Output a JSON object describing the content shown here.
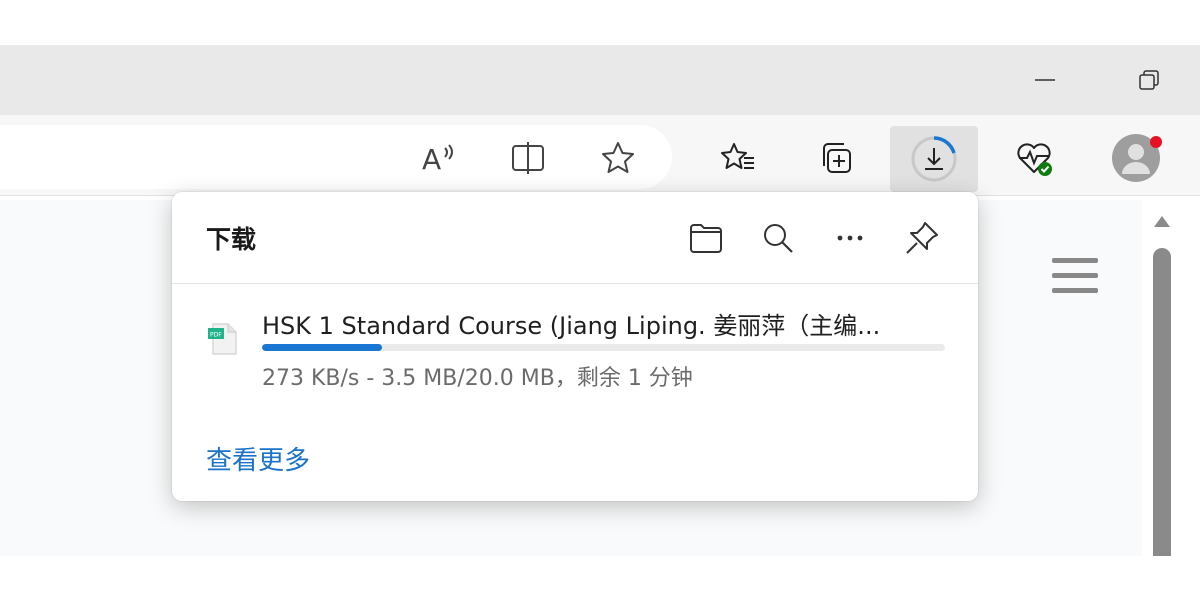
{
  "window": {
    "minimize_icon": "minimize-icon",
    "restore_icon": "restore-icon"
  },
  "toolbar": {
    "read_aloud_icon": "read-aloud-icon",
    "split_screen_icon": "split-screen-icon",
    "favorite_icon": "star-icon",
    "favorites_icon": "favorites-list-icon",
    "collections_icon": "collections-icon",
    "downloads_icon": "download-progress-icon",
    "browser_essentials_icon": "heart-pulse-icon",
    "profile_icon": "profile-avatar-icon"
  },
  "downloads_panel": {
    "title": "下载",
    "open_folder_icon": "folder-icon",
    "search_icon": "search-icon",
    "more_icon": "more-options-icon",
    "pin_icon": "pin-icon",
    "item": {
      "file_type_icon": "pdf-file-icon",
      "file_badge": "PDF",
      "file_name": "HSK 1 Standard Course (Jiang Liping. 姜丽萍（主编...",
      "status": "273 KB/s - 3.5 MB/20.0 MB，剩余 1 分钟",
      "progress_fraction": 0.175
    },
    "see_more": "查看更多"
  },
  "colors": {
    "accent": "#1976d2",
    "link": "#1a73c8",
    "notification_dot": "#e81123",
    "status_ok": "#107c10"
  }
}
